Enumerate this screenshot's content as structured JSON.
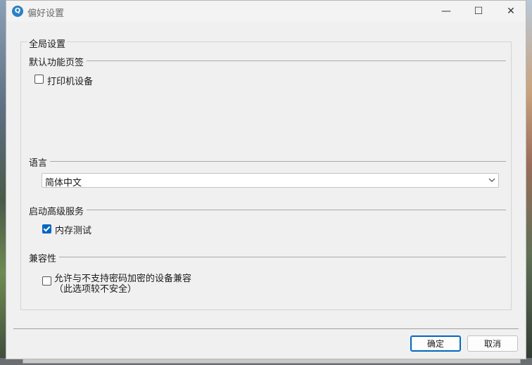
{
  "window": {
    "title": "偏好设置",
    "minimize_glyph": "—",
    "maximize_glyph": "☐",
    "close_glyph": "✕"
  },
  "global_group": {
    "title": "全局设置"
  },
  "default_tab": {
    "label": "默认功能页签",
    "printer_checkbox": {
      "label": "打印机设备",
      "checked": false
    }
  },
  "language": {
    "label": "语言",
    "selected": "简体中文"
  },
  "advanced_services": {
    "label": "启动高级服务",
    "memory_test": {
      "label": "内存测试",
      "checked": true
    }
  },
  "compatibility": {
    "label": "兼容性",
    "allow_unencrypted": {
      "line1": "允许与不支持密码加密的设备兼容",
      "line2": "（此选项较不安全）",
      "checked": false
    }
  },
  "buttons": {
    "ok": "确定",
    "cancel": "取消"
  },
  "colors": {
    "accent": "#0067c0"
  }
}
